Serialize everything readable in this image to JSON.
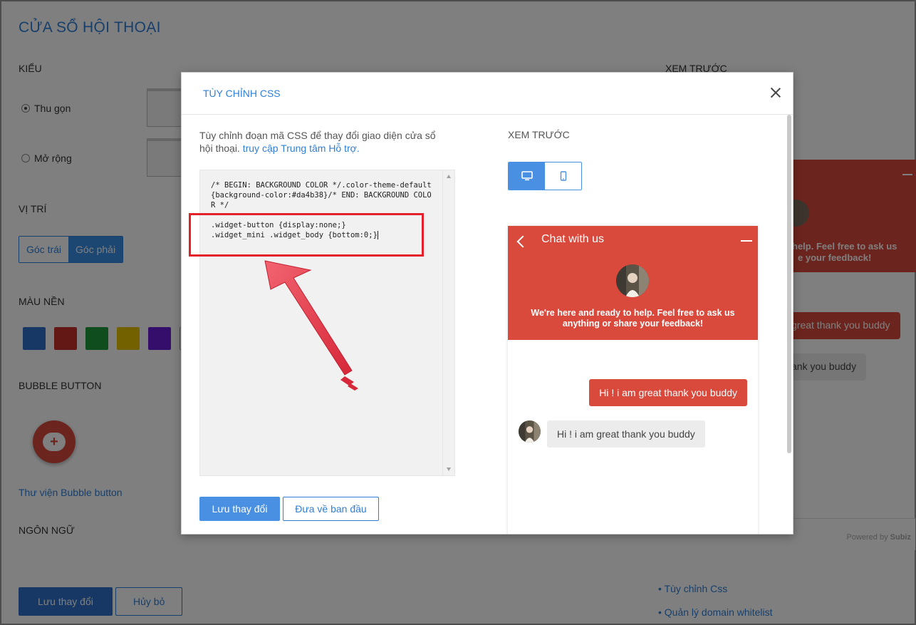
{
  "page": {
    "title": "CỬA SỔ HỘI THOẠI",
    "style_section": "KIỂU",
    "style_options": [
      "Thu gọn",
      "Mở rộng"
    ],
    "position_section": "VỊ TRÍ",
    "position_left": "Góc trái",
    "position_right": "Góc phải",
    "bg_color_section": "MÀU NỀN",
    "swatch_colors": [
      "#2f6fc8",
      "#c9302c",
      "#1e9b3c",
      "#e6c200",
      "#6a1bd6"
    ],
    "bubble_section": "BUBBLE BUTTON",
    "bubble_library_link": "Thư viện Bubble button",
    "language_section": "NGÔN NGỮ",
    "save_button": "Lưu thay đổi",
    "cancel_button": "Hủy bỏ",
    "preview_section": "XEM TRƯỚC",
    "bg_preview_text_1": "help. Feel free to ask us",
    "bg_preview_text_2": "e your feedback!",
    "bg_preview_msg_out": "great thank you buddy",
    "bg_preview_msg_in": "ank you buddy",
    "powered_by_label": "Powered by",
    "powered_by_brand": "Subiz",
    "side_links": [
      "Tùy chỉnh Css",
      "Quản lý domain whitelist"
    ]
  },
  "modal": {
    "title": "TÙY CHỈNH CSS",
    "description": "Tùy chỉnh đoạn mã CSS để thay đổi giao diện cửa sổ hội thoại.",
    "help_link": "truy cập Trung tâm Hỗ trợ.",
    "code_line_1": "/* BEGIN: BACKGROUND COLOR */.color-theme-default{background-color:#da4b38}/* END: BACKGROUND COLOR */",
    "code_line_2": ".widget-button {display:none;}",
    "code_line_3": ".widget_mini .widget_body {bottom:0;}",
    "save_button": "Lưu thay đổi",
    "reset_button": "Đưa về ban đầu",
    "preview_label": "XEM TRƯỚC",
    "widget": {
      "header_title": "Chat with us",
      "welcome_text": "We're here and ready to help. Feel free to ask us anything or share your feedback!",
      "outgoing_message": "Hi ! i am great thank you buddy",
      "incoming_message": "Hi ! i am great thank you buddy",
      "brand_color": "#d94a3d"
    }
  },
  "annotation": {
    "highlight_color": "#e4212b",
    "arrow_color": "#e63946"
  }
}
